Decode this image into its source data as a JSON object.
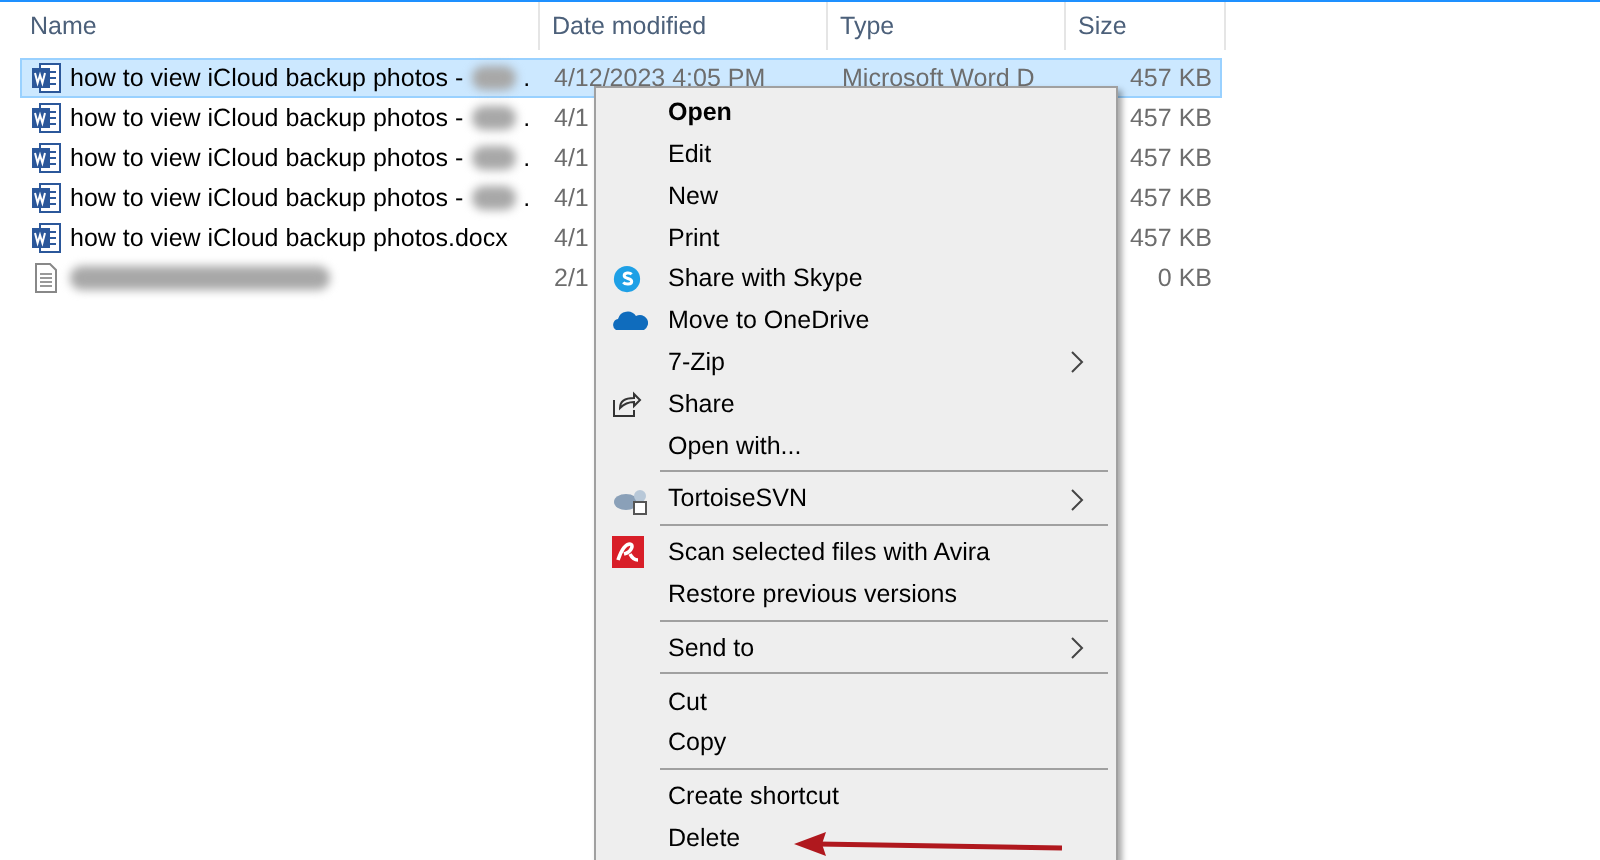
{
  "columns": [
    "Name",
    "Date modified",
    "Type",
    "Size"
  ],
  "files": [
    {
      "kind": "document",
      "name": "how to view iCloud backup photos -",
      "blurred": true,
      "name_end": ".",
      "date": "4/12/2023 4:05 PM",
      "type": "Microsoft Word D",
      "size": "457 KB",
      "selected": true
    },
    {
      "kind": "document",
      "name": "how to view iCloud backup photos -",
      "blurred": true,
      "name_end": ".",
      "date": "4/1",
      "size": "457 KB",
      "selected": false
    },
    {
      "kind": "document",
      "name": "how to view iCloud backup photos -",
      "blurred": true,
      "name_end": ".",
      "date": "4/1",
      "size": "457 KB",
      "selected": false
    },
    {
      "kind": "document",
      "name": "how to view iCloud backup photos -",
      "blurred": true,
      "name_end": ".",
      "date": "4/1",
      "size": "457 KB",
      "selected": false
    },
    {
      "kind": "document",
      "name": "how to view iCloud backup photos.docx",
      "date": "4/1",
      "size": "457 KB",
      "selected": false
    },
    {
      "kind": "text",
      "blurred": true,
      "date": "2/1",
      "size": "0 KB",
      "selected": false
    }
  ],
  "context_menu": [
    {
      "kind": "item",
      "label": "Open",
      "bold": true
    },
    {
      "kind": "item",
      "label": "Edit"
    },
    {
      "kind": "item",
      "label": "New"
    },
    {
      "kind": "item",
      "label": "Print"
    },
    {
      "kind": "skype",
      "label": "Share with Skype"
    },
    {
      "kind": "cloud",
      "label": "Move to OneDrive"
    },
    {
      "kind": "item",
      "label": "7-Zip",
      "submenu": true
    },
    {
      "kind": "share",
      "label": "Share"
    },
    {
      "kind": "item",
      "label": "Open with..."
    },
    {
      "kind": "separator"
    },
    {
      "kind": "tortoise",
      "label": "TortoiseSVN",
      "submenu": true
    },
    {
      "kind": "separator"
    },
    {
      "kind": "avira",
      "label": "Scan selected files with Avira"
    },
    {
      "kind": "item",
      "label": "Restore previous versions"
    },
    {
      "kind": "separator"
    },
    {
      "kind": "item",
      "label": "Send to",
      "submenu": true
    },
    {
      "kind": "separator"
    },
    {
      "kind": "item",
      "label": "Cut"
    },
    {
      "kind": "item",
      "label": "Copy"
    },
    {
      "kind": "separator"
    },
    {
      "kind": "item",
      "label": "Create shortcut"
    },
    {
      "kind": "item",
      "label": "Delete"
    }
  ]
}
